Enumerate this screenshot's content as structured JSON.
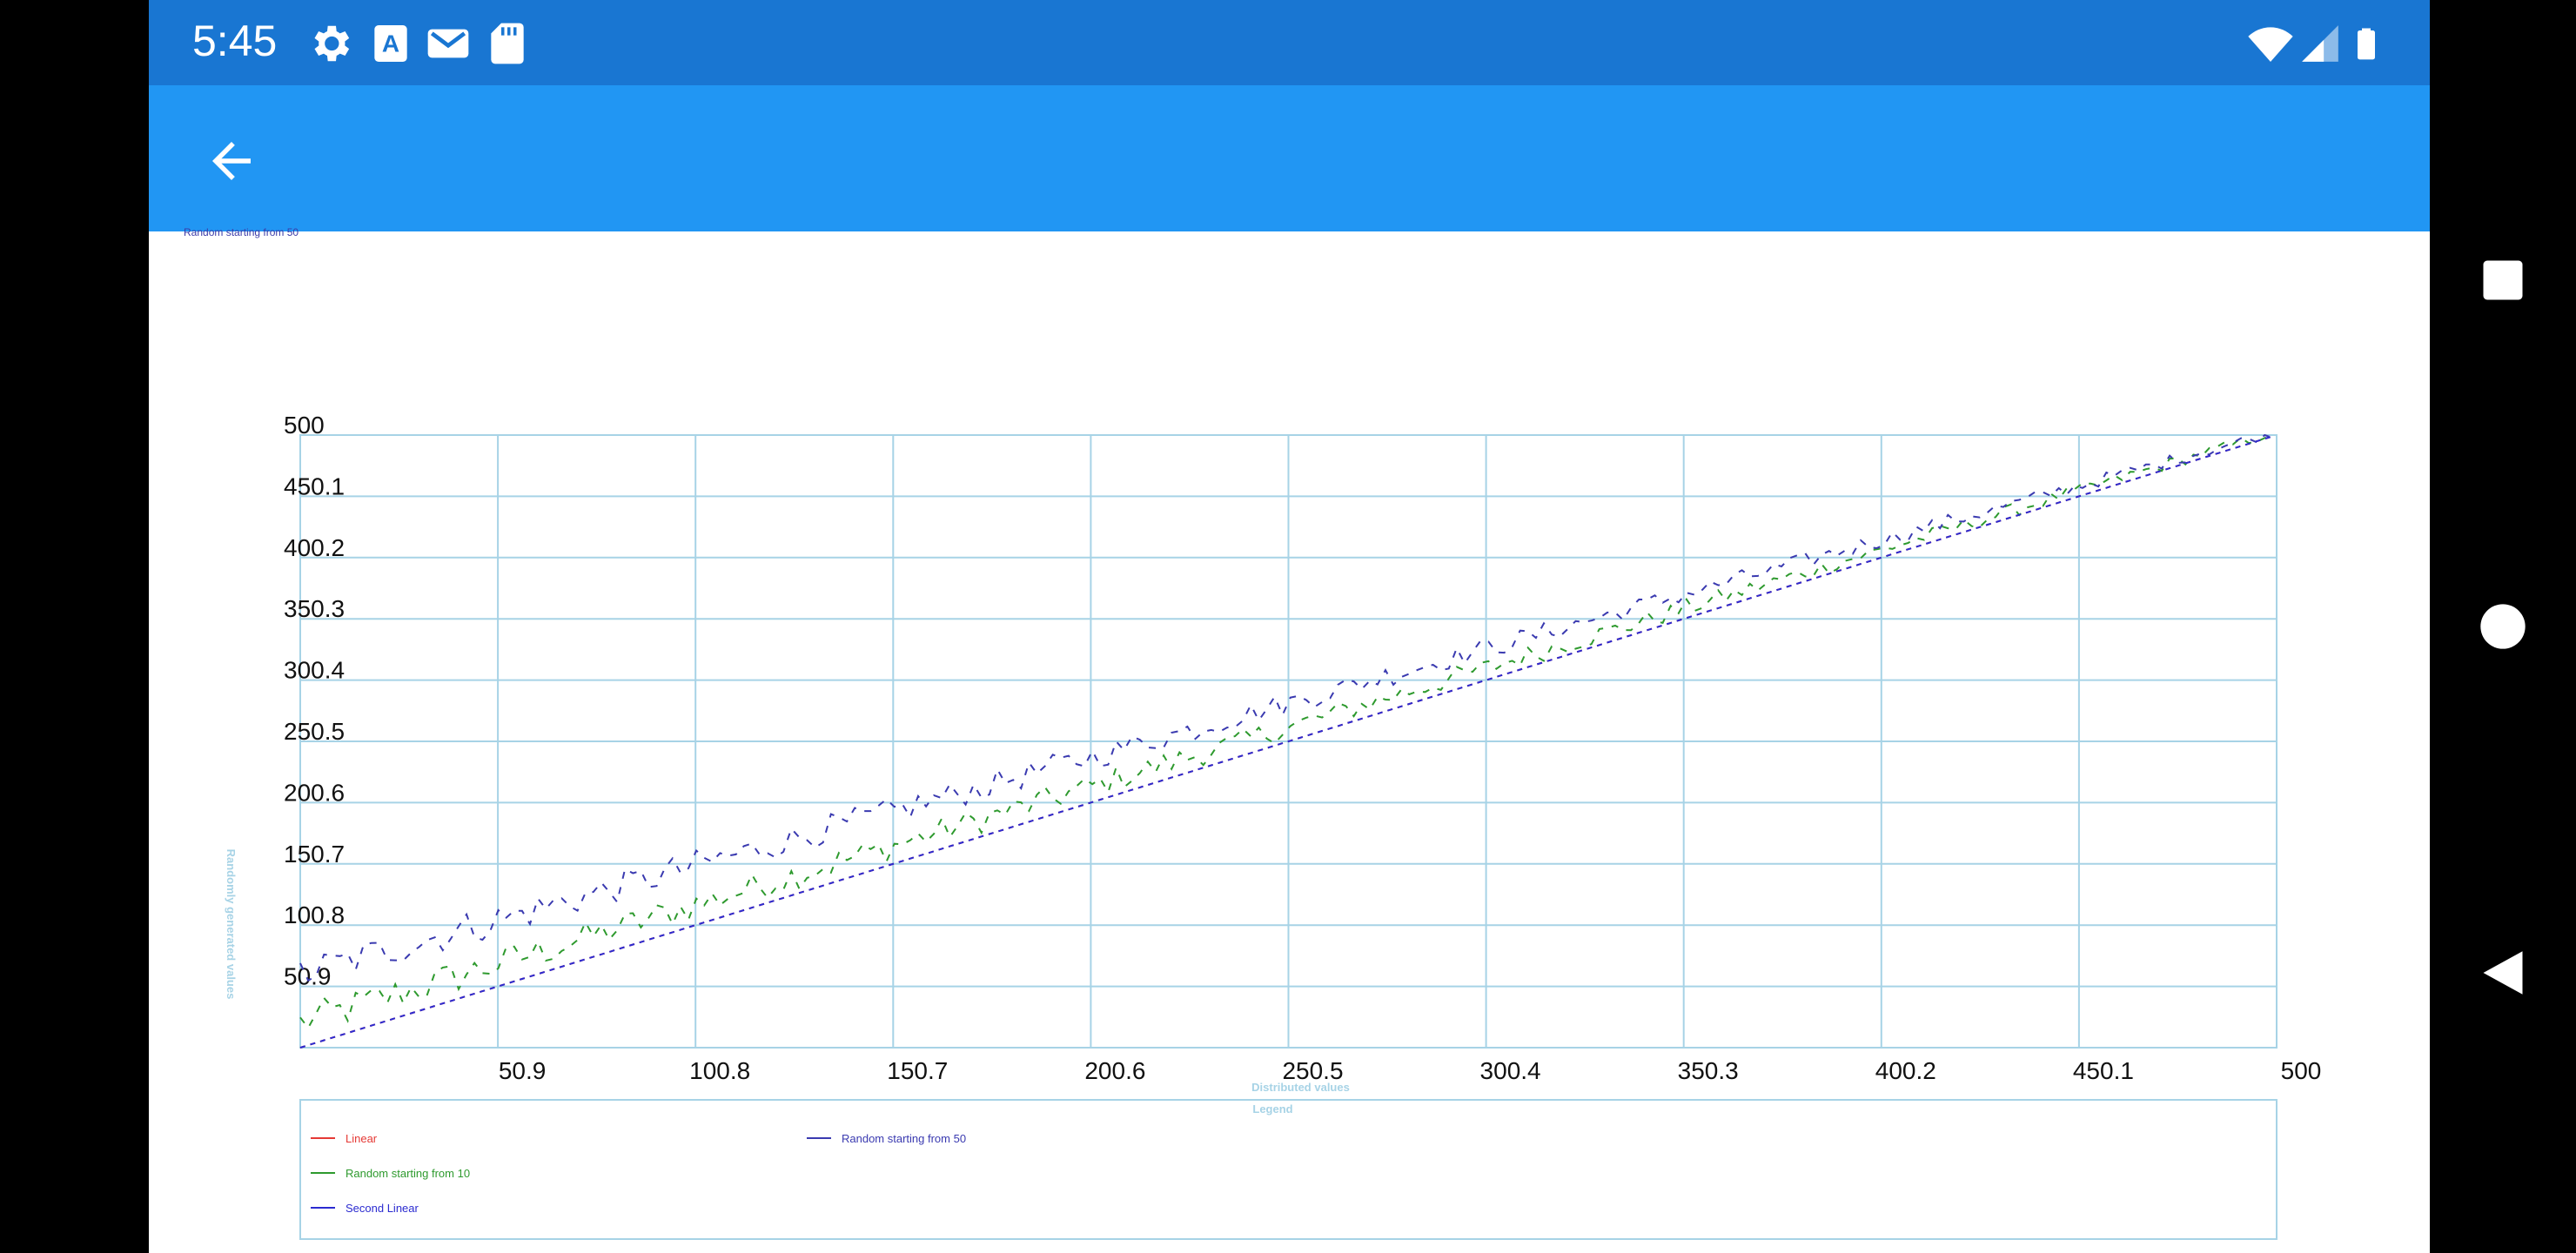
{
  "status_bar": {
    "time": "5:45",
    "left_icons": [
      "settings-icon",
      "text-a-icon",
      "gmail-icon",
      "sd-card-icon"
    ],
    "right_icons": [
      "wifi-icon",
      "signal-icon",
      "battery-icon"
    ]
  },
  "app_bar": {
    "back_icon": "arrow-back-icon"
  },
  "colors": {
    "status_bar": "#1976D2",
    "app_bar": "#2196F3",
    "grid": "#A7D3E6",
    "linear": "#E53935",
    "random10": "#2E9A2E",
    "random50": "#3A3AB0",
    "second_linear": "#2B2BD0"
  },
  "chart_data": {
    "type": "line",
    "title": "Random starting from 50",
    "xlabel": "Distributed values",
    "ylabel": "Randomly generated values",
    "xlim": [
      1,
      500
    ],
    "ylim": [
      1,
      500
    ],
    "x_ticks": [
      "50.9",
      "100.8",
      "150.7",
      "200.6",
      "250.5",
      "300.4",
      "350.3",
      "400.2",
      "450.1",
      "500"
    ],
    "y_ticks": [
      "50.9",
      "100.8",
      "150.7",
      "200.6",
      "250.5",
      "300.4",
      "350.3",
      "400.2",
      "450.1",
      "500"
    ],
    "grid": true,
    "legend_title": "Legend",
    "legend_position": "bottom",
    "series": [
      {
        "name": "Linear",
        "function": "y = x",
        "x_range": [
          1,
          500
        ],
        "style": "dashed"
      },
      {
        "name": "Random starting from 10",
        "function": "y ≈ x + noise, starts near 10",
        "x_range": [
          1,
          500
        ],
        "start": 10,
        "style": "dashed"
      },
      {
        "name": "Random starting from 50",
        "function": "y ≈ x + noise, starts near 50",
        "x_range": [
          1,
          500
        ],
        "start": 50,
        "style": "dashed"
      },
      {
        "name": "Second Linear",
        "function": "y = x",
        "x_range": [
          1,
          500
        ],
        "style": "dashed"
      }
    ]
  },
  "nav_bar": {
    "buttons": [
      "recents-icon",
      "home-icon",
      "back-nav-icon"
    ]
  }
}
